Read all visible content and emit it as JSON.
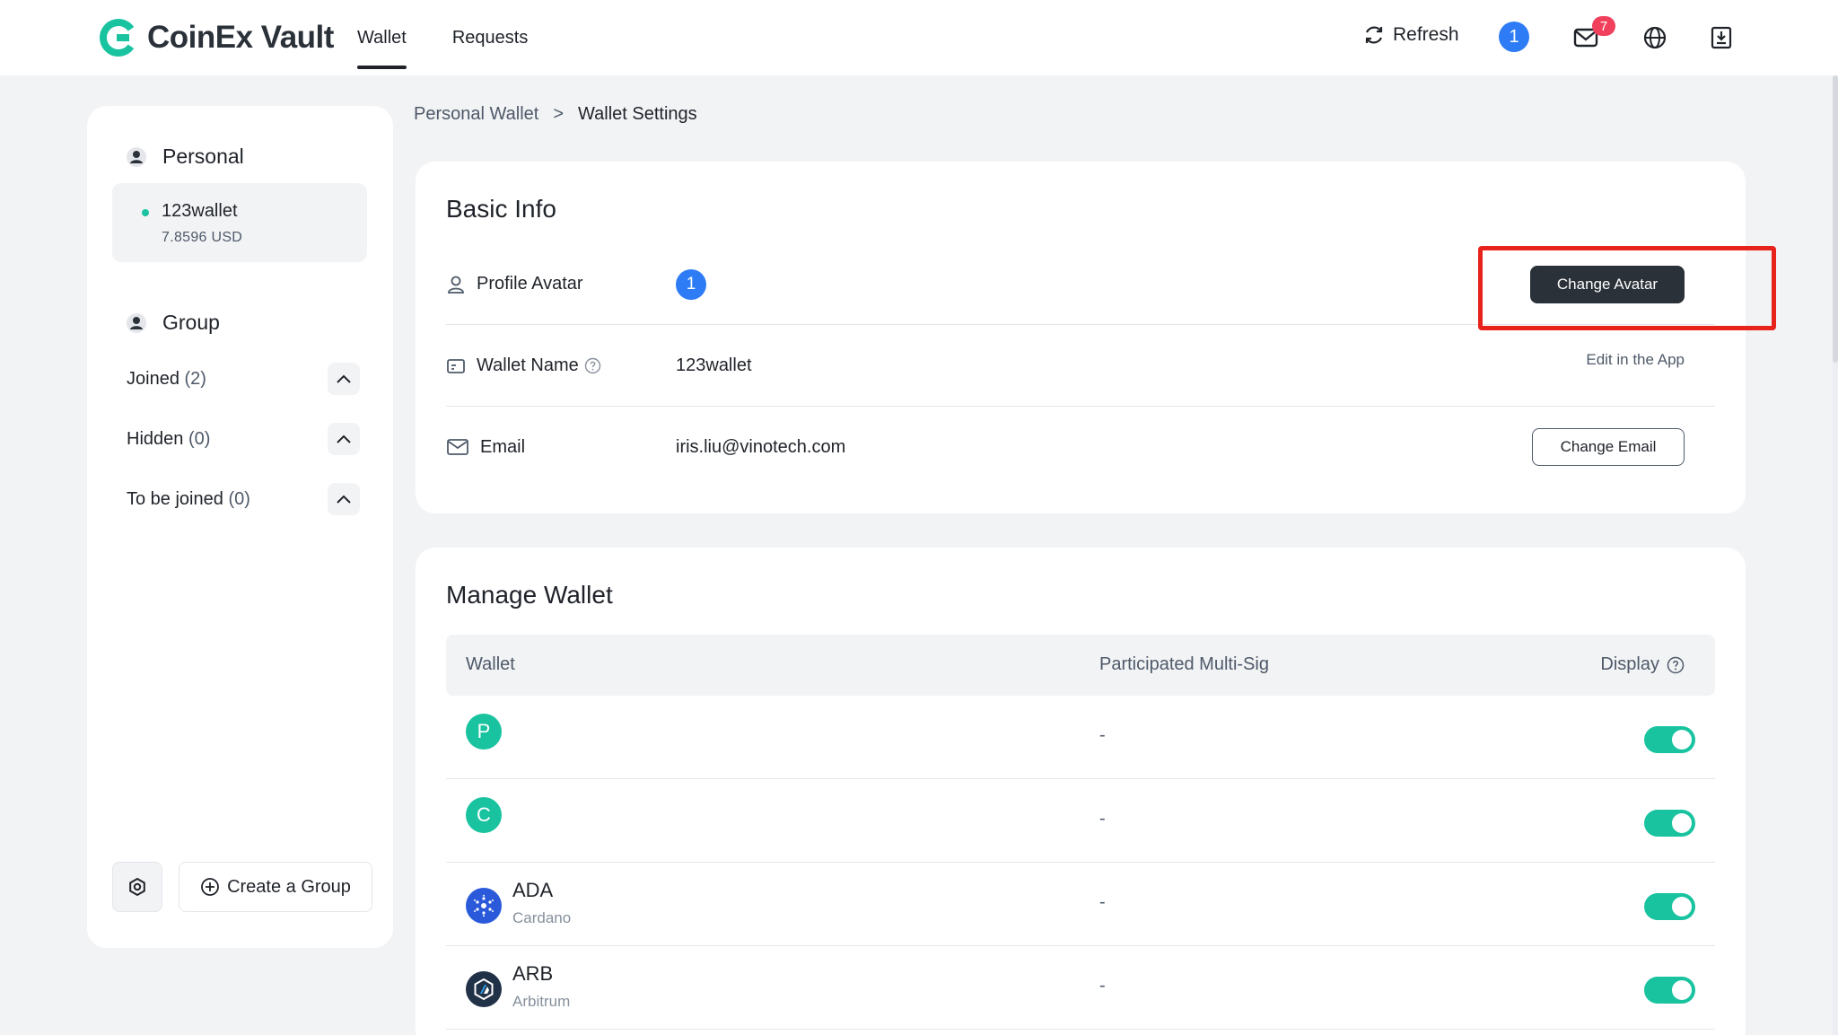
{
  "header": {
    "logo_text": "CoinEx Vault",
    "nav": [
      {
        "label": "Wallet",
        "active": true
      },
      {
        "label": "Requests",
        "active": false
      }
    ],
    "refresh_label": "Refresh",
    "avatar_initial": "1",
    "mail_badge": "7",
    "icons": [
      "refresh-icon",
      "mail-icon",
      "globe-icon",
      "download-icon"
    ]
  },
  "sidebar": {
    "personal_title": "Personal",
    "wallet": {
      "name": "123wallet",
      "balance": "7.8596 USD"
    },
    "group_title": "Group",
    "groups": [
      {
        "label": "Joined",
        "count": "(2)"
      },
      {
        "label": "Hidden",
        "count": "(0)"
      },
      {
        "label": "To be joined",
        "count": "(0)"
      }
    ],
    "create_group_label": "Create a Group"
  },
  "breadcrumb": {
    "parent": "Personal Wallet",
    "separator": ">",
    "current": "Wallet Settings"
  },
  "basic_info": {
    "title": "Basic Info",
    "avatar_label": "Profile Avatar",
    "avatar_initial": "1",
    "change_avatar_label": "Change Avatar",
    "wallet_name_label": "Wallet Name",
    "wallet_name_value": "123wallet",
    "edit_in_app": "Edit in the App",
    "email_label": "Email",
    "email_value": "iris.liu@vinotech.com",
    "change_email_label": "Change Email"
  },
  "manage_wallet": {
    "title": "Manage Wallet",
    "columns": {
      "wallet": "Wallet",
      "multisig": "Participated Multi-Sig",
      "display": "Display"
    },
    "rows": [
      {
        "initial": "P",
        "name": "",
        "sub": "",
        "multisig": "-",
        "display": true,
        "color": "#19c3a0"
      },
      {
        "initial": "C",
        "name": "",
        "sub": "",
        "multisig": "-",
        "display": true,
        "color": "#19c3a0"
      },
      {
        "initial": "",
        "name": "ADA",
        "sub": "Cardano",
        "multisig": "-",
        "display": true,
        "color": "#2a5ada"
      },
      {
        "initial": "",
        "name": "ARB",
        "sub": "Arbitrum",
        "multisig": "-",
        "display": true,
        "color": "#213147"
      }
    ]
  },
  "colors": {
    "accent_teal": "#19c3a0",
    "dark_button": "#2b3139",
    "avatar_blue": "#2d7cf6",
    "badge_red": "#f0405b",
    "highlight_red": "#e8231b"
  }
}
